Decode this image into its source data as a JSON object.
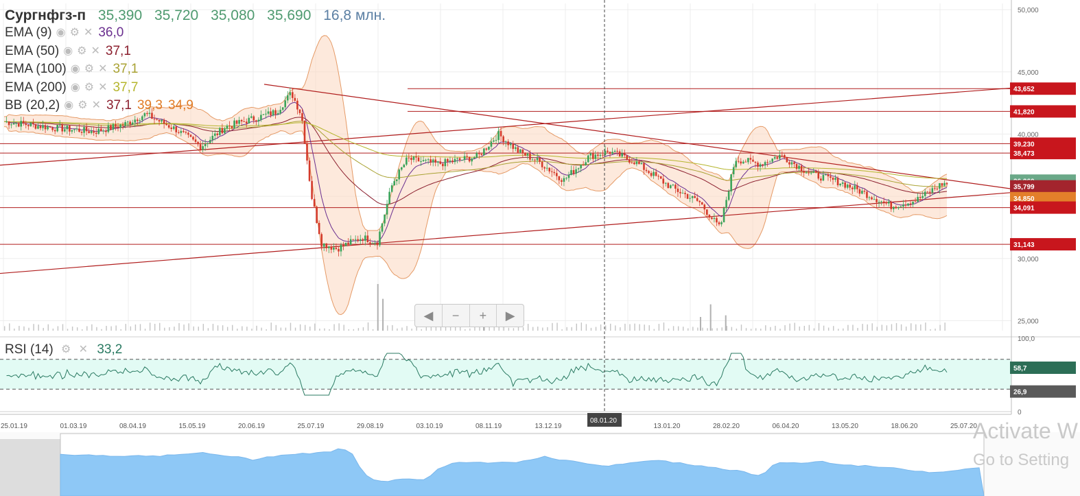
{
  "ticker": {
    "name": "Сургнфгз-п",
    "open": "35,390",
    "high": "35,720",
    "low": "35,080",
    "close": "35,690",
    "volume": "16,8 млн."
  },
  "indicators": [
    {
      "name": "EMA (9)",
      "values": [
        "36,0"
      ],
      "colors": [
        "#6a2f8f"
      ]
    },
    {
      "name": "EMA (50)",
      "values": [
        "37,1"
      ],
      "colors": [
        "#8b1f2e"
      ]
    },
    {
      "name": "EMA (100)",
      "values": [
        "37,1"
      ],
      "colors": [
        "#a9a233"
      ]
    },
    {
      "name": "EMA (200)",
      "values": [
        "37,7"
      ],
      "colors": [
        "#b5b52c"
      ]
    },
    {
      "name": "BB (20,2)",
      "values": [
        "37,1",
        "39,3",
        "34,9"
      ],
      "colors": [
        "#8b1f2e",
        "#e07b25",
        "#e07b25"
      ]
    }
  ],
  "rsi": {
    "name": "RSI (14)",
    "value": "33,2",
    "color": "#2a7a62"
  },
  "icons": {
    "eye": "eye-icon",
    "gear": "gear-icon",
    "close": "close-icon"
  },
  "navigator_buttons": {
    "left": "◀",
    "zoom_out": "−",
    "zoom_in": "+",
    "right": "▶"
  },
  "watermark": {
    "line1": "Activate W",
    "line2": "Go to Setting"
  },
  "colors": {
    "up_candle": "#3aa35a",
    "down_candle": "#d43a2a",
    "level_line": "#b01c1c",
    "band_fill": "#fbd7bf",
    "rsi_fill": "#e2fbf4",
    "navigator_fill": "#8ec8f6"
  },
  "chart_data": {
    "type": "candlestick",
    "x_ticks": [
      "25.01.19",
      "01.03.19",
      "08.04.19",
      "15.05.19",
      "20.06.19",
      "25.07.19",
      "29.08.19",
      "03.10.19",
      "08.11.19",
      "13.12.19",
      "08.01.20",
      "13.01.20",
      "28.02.20",
      "06.04.20",
      "13.05.20",
      "18.06.20",
      "25.07.20"
    ],
    "crosshair_date": "08.01.20",
    "y_ticks": [
      "50,000",
      "45,000",
      "40,000",
      "35,000",
      "30,000",
      "25,000"
    ],
    "ylim": [
      24.2,
      50.5
    ],
    "horizontal_levels": [
      "43,652",
      "41,820",
      "39,230",
      "38,473",
      "34,091",
      "31,143"
    ],
    "price_labels": [
      {
        "text": "43,652",
        "value": 43.652,
        "color": "#c8161d"
      },
      {
        "text": "41,820",
        "value": 41.82,
        "color": "#c8161d"
      },
      {
        "text": "39,230",
        "value": 39.23,
        "color": "#c8161d"
      },
      {
        "text": "38,473",
        "value": 38.473,
        "color": "#c8161d"
      },
      {
        "text": "36,260",
        "value": 36.26,
        "color": "#6aa888"
      },
      {
        "text": "35,799",
        "value": 35.799,
        "color": "#a3242d"
      },
      {
        "text": "34,850",
        "value": 34.85,
        "color": "#e37f2a"
      },
      {
        "text": "34,091",
        "value": 34.091,
        "color": "#c8161d"
      },
      {
        "text": "31,143",
        "value": 31.143,
        "color": "#c8161d"
      }
    ],
    "rsi_ticks": [
      "100,0",
      "0"
    ],
    "rsi_levels": [
      {
        "text": "58,7",
        "value": 58.7,
        "color": "#2c6e56"
      },
      {
        "text": "26,9",
        "value": 26.9,
        "color": "#5a5a5a"
      }
    ],
    "rsi_ylim": [
      0,
      100
    ],
    "trendlines": [
      {
        "x": [
          0,
          1474
        ],
        "y": [
          37.5,
          43.7
        ]
      },
      {
        "x": [
          0,
          1474
        ],
        "y": [
          28.8,
          35.3
        ]
      },
      {
        "x": [
          385,
          1474
        ],
        "y": [
          44.0,
          35.6
        ]
      }
    ],
    "anchors": [
      [
        0,
        41.0
      ],
      [
        0.05,
        40.5
      ],
      [
        0.09,
        40.2
      ],
      [
        0.12,
        40.8
      ],
      [
        0.14,
        41.6
      ],
      [
        0.17,
        40.4
      ],
      [
        0.195,
        39.0
      ],
      [
        0.22,
        40.6
      ],
      [
        0.25,
        41.3
      ],
      [
        0.27,
        41.8
      ],
      [
        0.285,
        43.3
      ],
      [
        0.295,
        41.5
      ],
      [
        0.305,
        35.0
      ],
      [
        0.315,
        31.2
      ],
      [
        0.33,
        30.8
      ],
      [
        0.355,
        31.7
      ],
      [
        0.37,
        31.3
      ],
      [
        0.385,
        36.0
      ],
      [
        0.4,
        38.0
      ],
      [
        0.43,
        37.6
      ],
      [
        0.47,
        38.2
      ],
      [
        0.49,
        40.0
      ],
      [
        0.51,
        38.6
      ],
      [
        0.53,
        37.8
      ],
      [
        0.555,
        36.3
      ],
      [
        0.58,
        38.2
      ],
      [
        0.6,
        38.6
      ],
      [
        0.625,
        37.8
      ],
      [
        0.66,
        35.8
      ],
      [
        0.69,
        34.5
      ],
      [
        0.71,
        32.4
      ],
      [
        0.725,
        38.0
      ],
      [
        0.75,
        37.6
      ],
      [
        0.77,
        38.3
      ],
      [
        0.8,
        36.8
      ],
      [
        0.83,
        36.1
      ],
      [
        0.86,
        35.0
      ],
      [
        0.88,
        34.2
      ],
      [
        0.905,
        34.7
      ],
      [
        0.93,
        36.0
      ]
    ],
    "volume_ylim": [
      0,
      100
    ],
    "volume": [
      {
        "x": 0.37,
        "value": 85
      },
      {
        "x": 0.375,
        "value": 58
      },
      {
        "x": 0.7,
        "value": 48
      },
      {
        "x": 0.69,
        "value": 25
      },
      {
        "x": 0.715,
        "value": 28
      },
      {
        "x": 0.475,
        "value": 22
      }
    ]
  }
}
